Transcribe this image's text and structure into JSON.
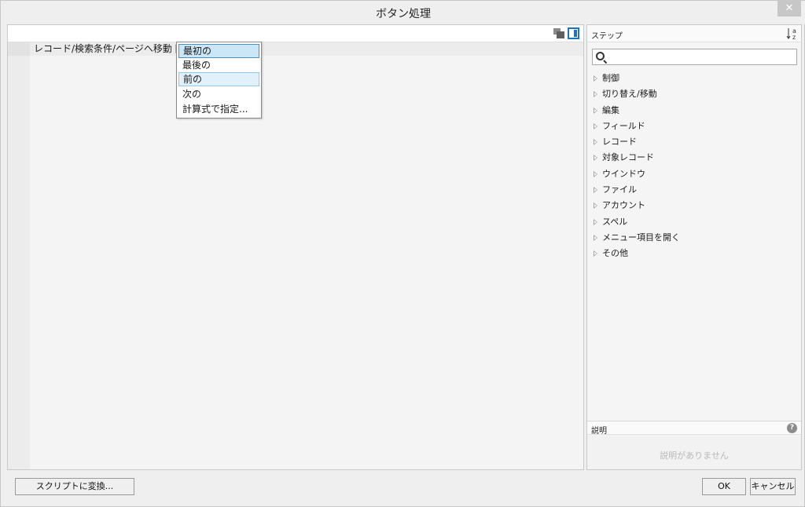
{
  "window": {
    "title": "ボタン処理",
    "close_glyph": "✕"
  },
  "editor": {
    "script_step": "レコード/検索条件/ページへ移動 [",
    "dropdown": {
      "options": [
        "最初の",
        "最後の",
        "前の",
        "次の",
        "計算式で指定..."
      ]
    }
  },
  "steps_panel": {
    "header": "ステップ",
    "sort_icon_label": "↓a z",
    "search": {
      "value": "",
      "placeholder": ""
    },
    "categories": [
      "制御",
      "切り替え/移動",
      "編集",
      "フィールド",
      "レコード",
      "対象レコード",
      "ウインドウ",
      "ファイル",
      "アカウント",
      "スペル",
      "メニュー項目を開く",
      "その他"
    ]
  },
  "description": {
    "header": "説明",
    "help_glyph": "?",
    "empty_text": "説明がありません"
  },
  "buttons": {
    "convert": "スクリプトに変換...",
    "ok": "OK",
    "cancel": "キャンセル"
  },
  "colors": {
    "accent": "#1e73be",
    "selection": "#cbe6f7"
  }
}
